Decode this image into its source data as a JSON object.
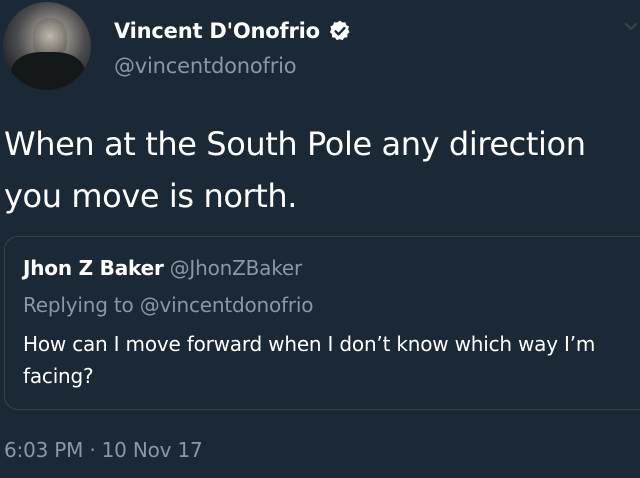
{
  "author": {
    "display_name": "Vincent D'Onofrio",
    "handle": "@vincentdonofrio",
    "verified": true
  },
  "tweet": {
    "text": "When at the South Pole any direction you move is north.",
    "timestamp": "6:03 PM · 10 Nov 17"
  },
  "quoted": {
    "display_name": "Jhon Z Baker",
    "handle": "@JhonZBaker",
    "replying_to": "Replying to @vincentdonofrio",
    "text": "How can I move forward when I don’t know which way I’m facing?"
  },
  "colors": {
    "background": "#1b2836",
    "text": "#ffffff",
    "muted": "#8899a6",
    "border": "#38444d"
  },
  "icons": {
    "verified": "verified-badge-icon",
    "menu": "chevron-down-icon"
  }
}
